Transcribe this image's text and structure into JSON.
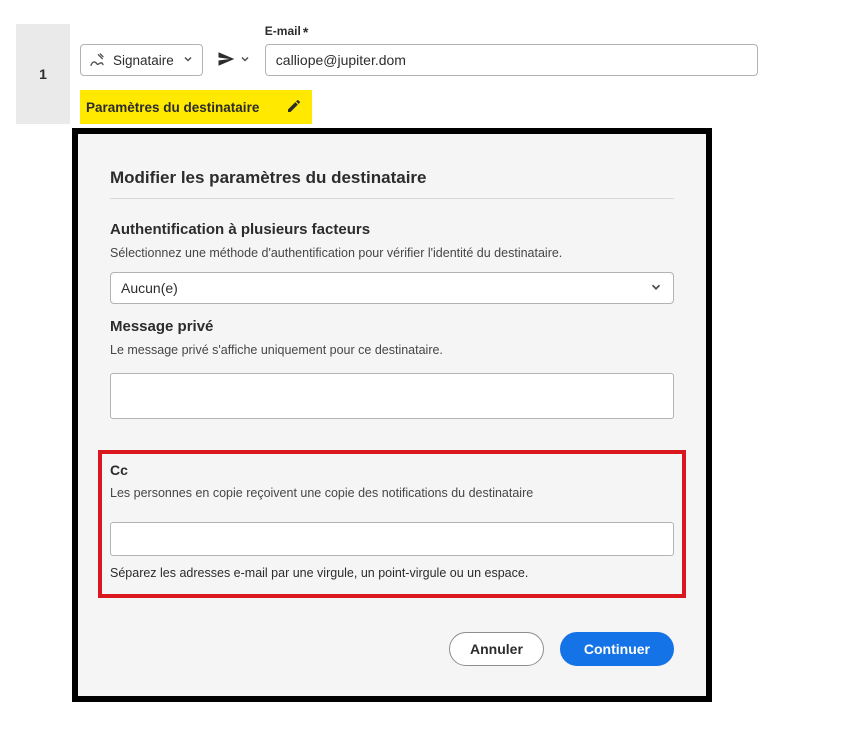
{
  "row": {
    "number": "1",
    "role_label": "Signataire",
    "email_label": "E-mail",
    "email_required_mark": "*",
    "email_value": "calliope@jupiter.dom",
    "settings_label": "Paramètres du destinataire"
  },
  "dialog": {
    "title": "Modifier les paramètres du destinataire",
    "auth_title": "Authentification à plusieurs facteurs",
    "auth_desc": "Sélectionnez une méthode d'authentification pour vérifier l'identité du destinataire.",
    "auth_value": "Aucun(e)",
    "msg_title": "Message privé",
    "msg_desc": "Le message privé s'affiche uniquement pour ce destinataire.",
    "msg_value": "",
    "cc_title": "Cc",
    "cc_desc": "Les personnes en copie reçoivent une copie des notifications du destinataire",
    "cc_value": "",
    "cc_hint": "Séparez les adresses e-mail par une virgule, un point-virgule ou un espace.",
    "cancel": "Annuler",
    "continue": "Continuer"
  }
}
